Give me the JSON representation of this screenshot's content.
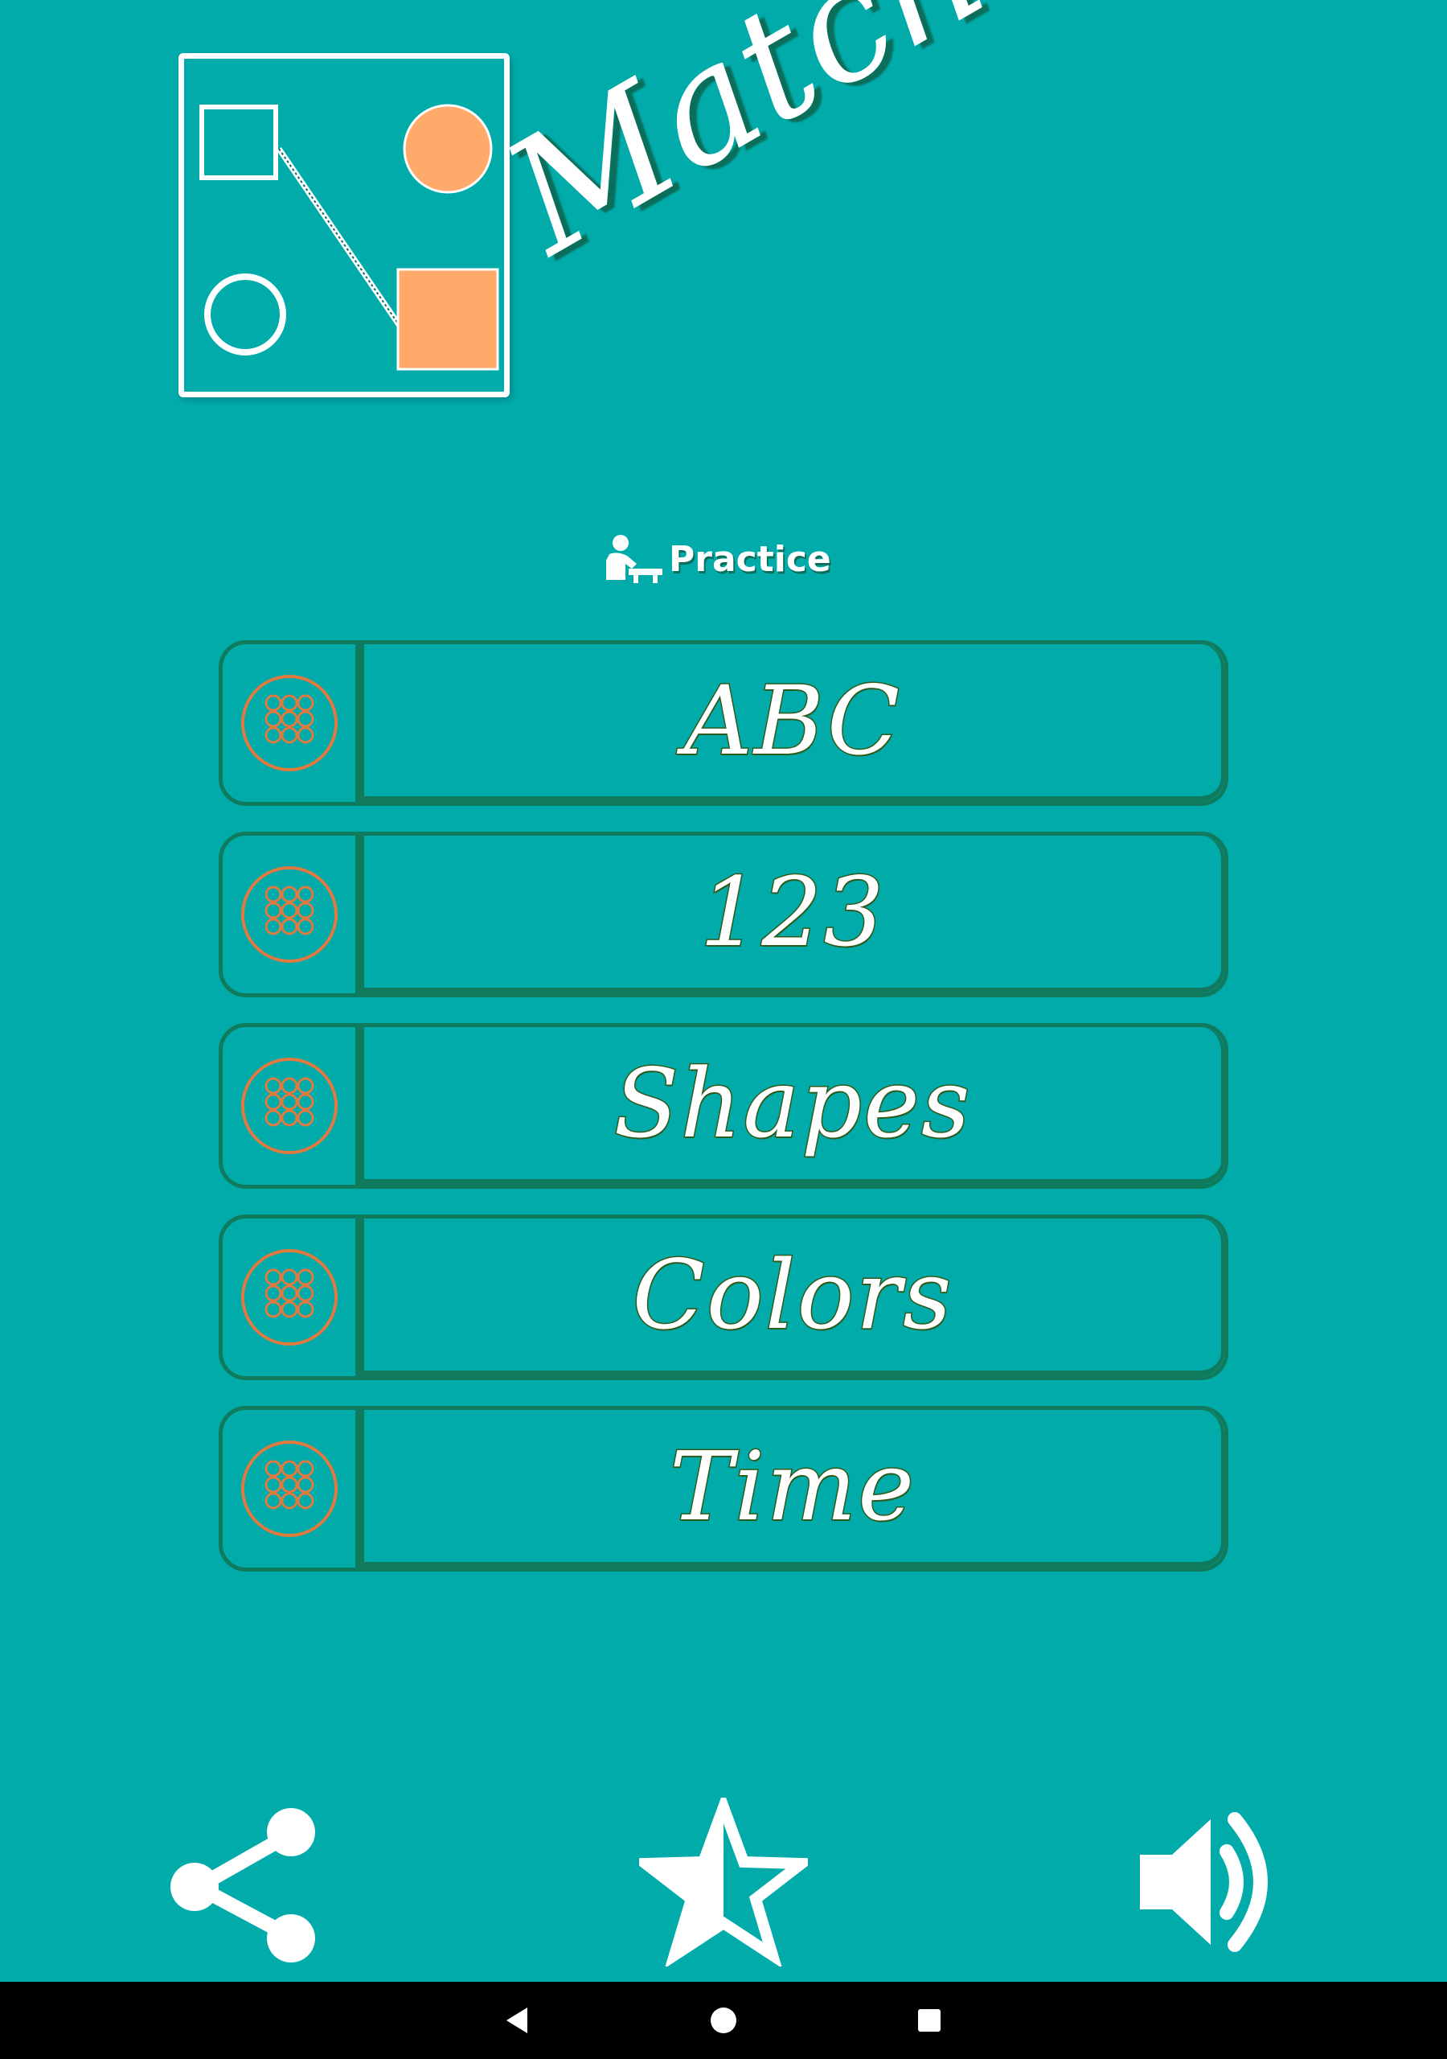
{
  "app": {
    "title": "Match It",
    "background_color": "#01ABAA",
    "accent_color": "#FFA96B",
    "border_color": "#0F7A5C"
  },
  "logo": {
    "icon": "match-shapes-logo-icon"
  },
  "practice": {
    "icon": "student-desk-icon",
    "label": "Practice"
  },
  "menu": {
    "items": [
      {
        "label": "ABC",
        "icon": "dots-grid-icon"
      },
      {
        "label": "123",
        "icon": "dots-grid-icon"
      },
      {
        "label": "Shapes",
        "icon": "dots-grid-icon"
      },
      {
        "label": "Colors",
        "icon": "dots-grid-icon"
      },
      {
        "label": "Time",
        "icon": "dots-grid-icon"
      }
    ]
  },
  "bottom_bar": {
    "share_icon": "share-icon",
    "rate_icon": "star-half-icon",
    "sound_icon": "volume-icon"
  },
  "system_nav": {
    "back_icon": "back-triangle-icon",
    "home_icon": "home-circle-icon",
    "recents_icon": "recents-square-icon"
  }
}
